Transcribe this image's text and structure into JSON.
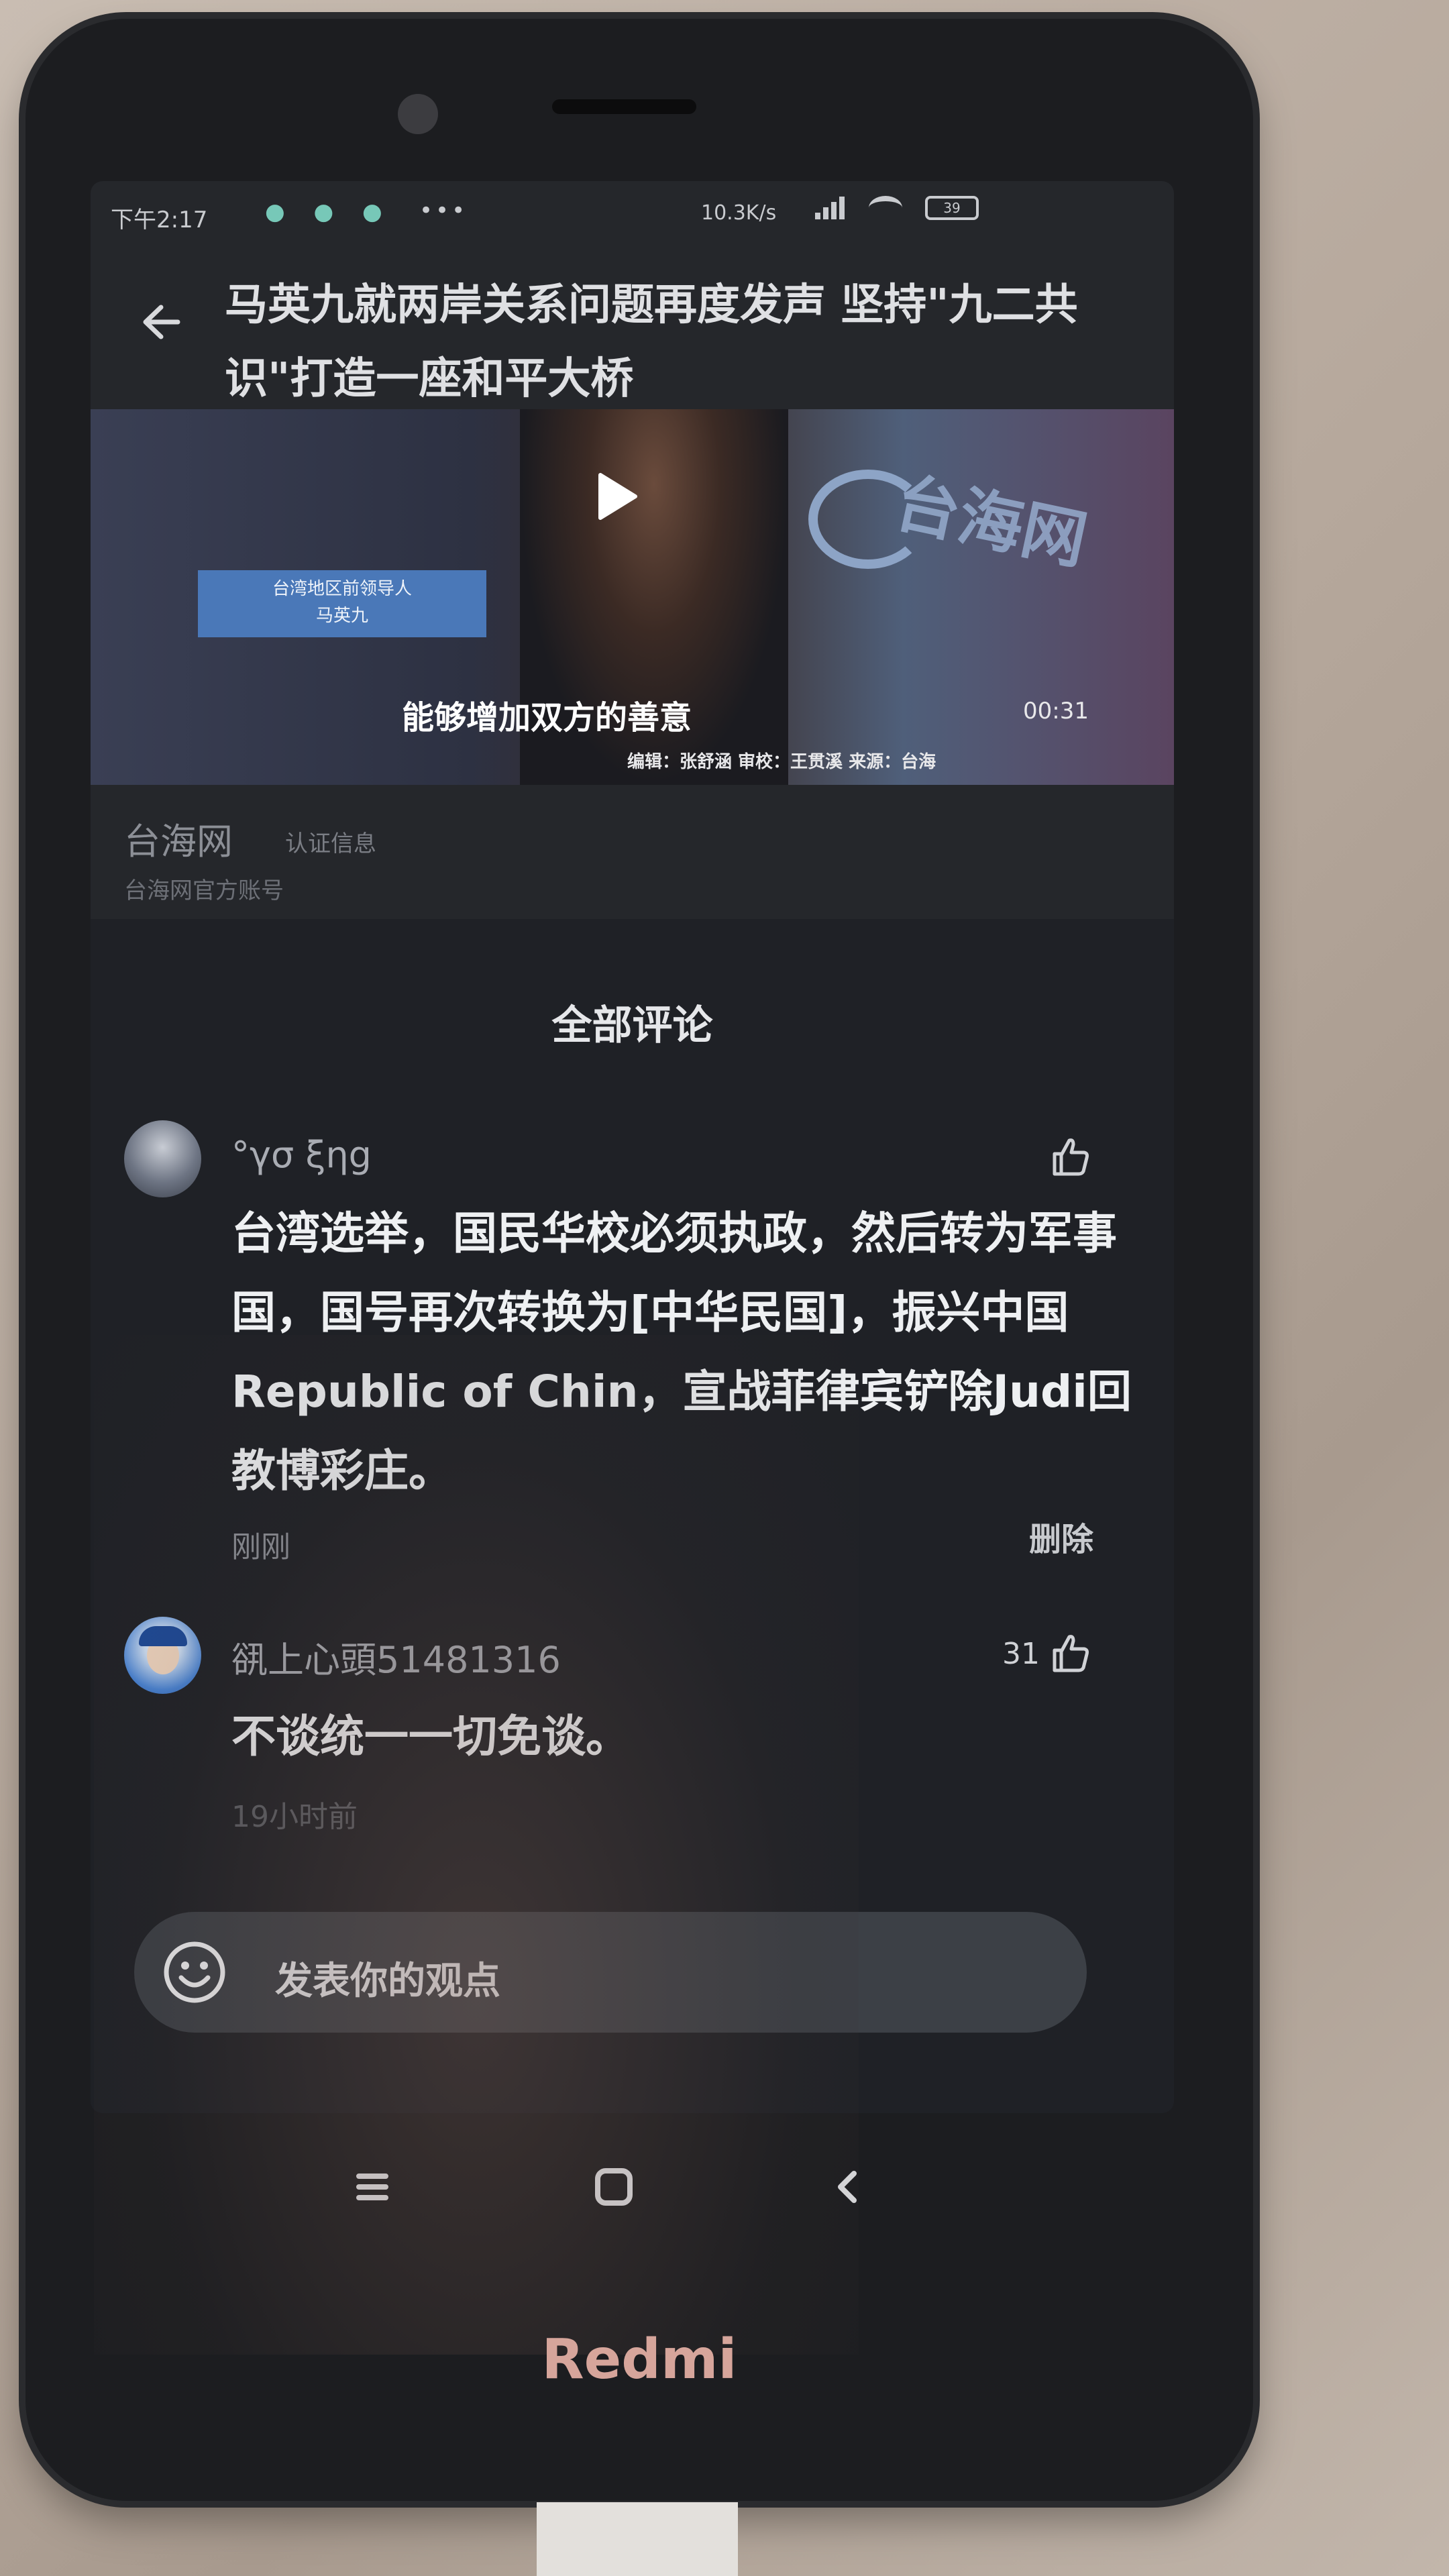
{
  "status_bar": {
    "time": "下午2:17",
    "dots": "● ● ●",
    "more": "•••",
    "network_speed": "10.3K/s",
    "battery": "39"
  },
  "header": {
    "back_icon": "back-arrow-icon",
    "title": "马英九就两岸关系问题再度发声 坚持\"九二共识\"打造一座和平大桥"
  },
  "video": {
    "lower_third_line1": "台湾地区前领导人",
    "lower_third_line2": "马英九",
    "subtitle": "能够增加双方的善意",
    "duration": "00:31",
    "credits": "编辑：张舒涵 审校：王贯溪 来源：台海",
    "logo_text": "台海网"
  },
  "account": {
    "name": "台海网",
    "tag": "认证信息",
    "description": "台海网官方账号"
  },
  "comments": {
    "title": "全部评论",
    "items": [
      {
        "username": "°γσ ξηg",
        "likes": "",
        "text": "台湾选举，国民华校必须执政，然后转为军事国，国号再次转换为[中华民国]，振兴中国Republic of Chin，宣战菲律宾铲除Judi回教博彩庄。",
        "time": "刚刚",
        "action": "删除"
      },
      {
        "username": "谻上心頭51481316",
        "likes": "31",
        "text": "不谈统一一切免谈。",
        "time": "19小时前"
      }
    ]
  },
  "input": {
    "placeholder": "发表你的观点"
  },
  "brand": "Redmi"
}
